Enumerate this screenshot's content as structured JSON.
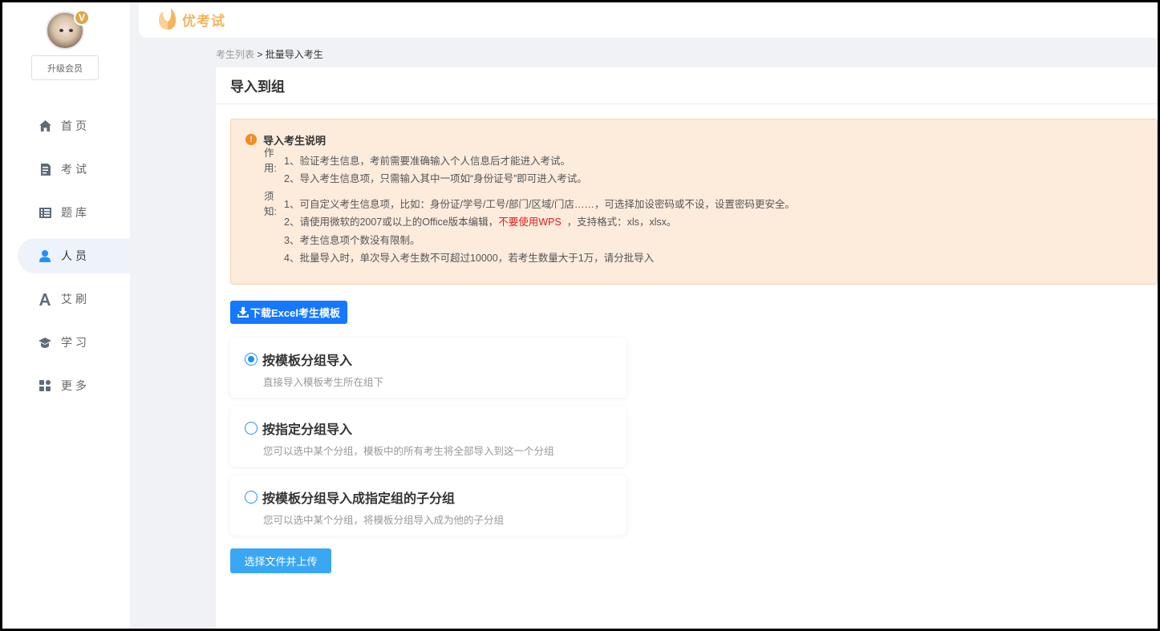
{
  "sidebar": {
    "vip_badge": "V",
    "upgrade_label": "升级会员",
    "items": [
      {
        "label": "首页",
        "icon": "home-icon",
        "active": false
      },
      {
        "label": "考试",
        "icon": "exam-icon",
        "active": false
      },
      {
        "label": "题库",
        "icon": "question-bank-icon",
        "active": false
      },
      {
        "label": "人员",
        "icon": "user-icon",
        "active": true
      },
      {
        "label": "艾刷",
        "icon": "font-a-icon",
        "active": false
      },
      {
        "label": "学习",
        "icon": "graduation-cap-icon",
        "active": false
      },
      {
        "label": "更多",
        "icon": "grid-more-icon",
        "active": false
      }
    ]
  },
  "header": {
    "logo_text": "优考试"
  },
  "breadcrumb": {
    "parent": "考生列表",
    "separator": ">",
    "current": "批量导入考生"
  },
  "main": {
    "title": "导入到组",
    "notice": {
      "title": "导入考生说明",
      "purpose_label": "作用:",
      "purpose_lines": [
        "1、验证考生信息，考前需要准确输入个人信息后才能进入考试。",
        "2、导入考生信息项，只需输入其中一项如“身份证号”即可进入考试。"
      ],
      "must_label": "须知:",
      "must_line1": "1、可自定义考生信息项，比如：身份证/学号/工号/部门/区域/门店……，可选择加设密码或不设，设置密码更安全。",
      "must_line2_pre": "2、请使用微软的2007或以上的Office版本编辑，",
      "must_line2_red": "不要使用WPS",
      "must_line2_post": "，支持格式：xls，xlsx。",
      "must_line3": "3、考生信息项个数没有限制。",
      "must_line4": "4、批量导入时，单次导入考生数不可超过10000，若考生数量大于1万，请分批导入"
    },
    "download_label": "下载Excel考生模板",
    "options": [
      {
        "title": "按模板分组导入",
        "desc": "直接导入模板考生所在组下",
        "checked": true
      },
      {
        "title": "按指定分组导入",
        "desc": "您可以选中某个分组，模板中的所有考生将全部导入到这一个分组",
        "checked": false
      },
      {
        "title": "按模板分组导入成指定组的子分组",
        "desc": "您可以选中某个分组，将模板分组导入成为他的子分组",
        "checked": false
      }
    ],
    "upload_label": "选择文件并上传"
  },
  "colors": {
    "primary": "#1677ff",
    "logo": "#f6b45a",
    "notice_bg": "#fdebdc",
    "warn": "#f58a1f",
    "danger": "#e02020"
  }
}
